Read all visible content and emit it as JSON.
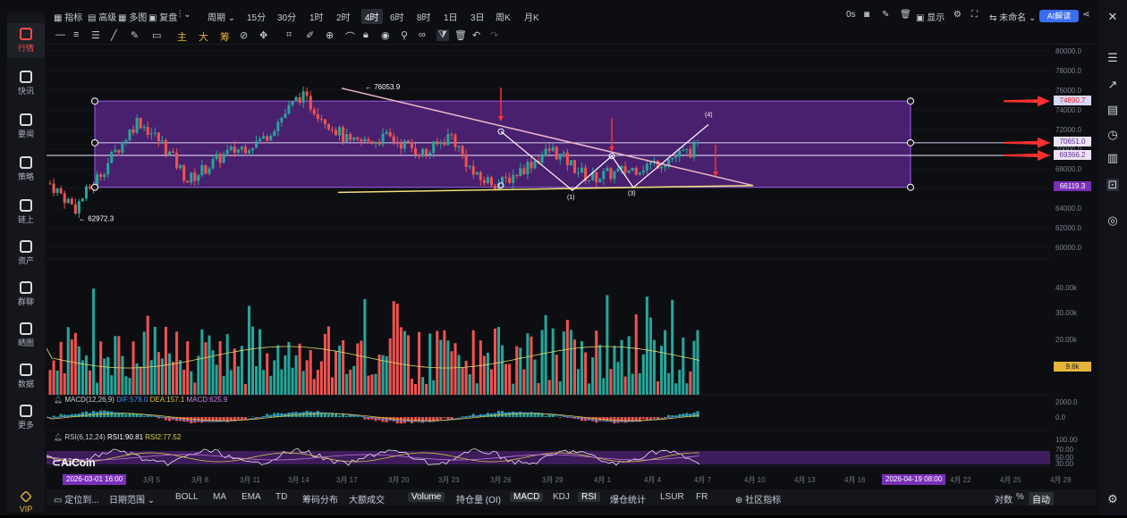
{
  "nav": [
    {
      "label": "行情",
      "icon": "bar-chart-icon",
      "active": true
    },
    {
      "label": "快讯",
      "icon": "news-icon"
    },
    {
      "label": "要闻",
      "icon": "document-icon"
    },
    {
      "label": "策略",
      "icon": "robot-icon"
    },
    {
      "label": "链上",
      "icon": "chain-icon"
    },
    {
      "label": "资产",
      "icon": "wallet-icon"
    },
    {
      "label": "群聊",
      "icon": "chat-icon"
    },
    {
      "label": "晒图",
      "icon": "image-icon"
    },
    {
      "label": "数据",
      "icon": "monitor-icon"
    },
    {
      "label": "更多",
      "icon": "grid-icon"
    },
    {
      "label": "VIP",
      "icon": "diamond-icon"
    }
  ],
  "topbar": {
    "indicators": "指标",
    "advanced": "高级",
    "multi": "多图",
    "restore": "复盘",
    "period": "周期",
    "timeframes": [
      "15分",
      "30分",
      "1时",
      "2时",
      "4时",
      "6时",
      "8时",
      "1日",
      "3日",
      "周K",
      "月K"
    ],
    "active_tf": "4时",
    "zero_s": "0s",
    "show": "显示",
    "unnamed": "未命名",
    "ai": "AI解读"
  },
  "drawbar": {
    "main": "主",
    "big": "大",
    "chip": "筹"
  },
  "price_axis": [
    "80000.0",
    "78000.0",
    "76000.0",
    "74000.0",
    "72000.0",
    "70000.0",
    "68000.0",
    "66000.0",
    "64000.0",
    "62000.0",
    "60000.0"
  ],
  "price_tags": [
    {
      "value": "74890.7",
      "bg": "#d6d9f7",
      "color": "#e02020"
    },
    {
      "value": "70651.0",
      "bg": "#ede3f7",
      "color": "#5b2e8a"
    },
    {
      "value": "69366.2",
      "bg": "#ede3f7",
      "color": "#5b2e8a"
    },
    {
      "value": "66119.3",
      "bg": "#7a2fb8",
      "color": "#ffffff"
    }
  ],
  "annotations": {
    "high": "76053.9",
    "low": "62972.3",
    "wave_labels": [
      "(1)",
      "(3)",
      "(4)"
    ]
  },
  "volume_axis": [
    "40.00k",
    "30.00k",
    "20.00k"
  ],
  "volume_tag": "9.6k",
  "macd": {
    "name": "MACD(12,26,9)",
    "dif": "DIF:578.0",
    "dea": "DEA:157.1",
    "macd": "MACD:625.9",
    "axis": [
      "2000.0",
      "0.0"
    ]
  },
  "rsi": {
    "name": "RSI(6,12,24)",
    "rsi1": "RSI1:90.81",
    "rsi2": "RSI2:77.52",
    "axis": [
      "100.00",
      "70.00",
      "50.00",
      "30.00"
    ]
  },
  "logo": "AiCoin",
  "time_axis": [
    "3月 5",
    "3月 8",
    "3月 11",
    "3月 14",
    "3月 17",
    "3月 20",
    "3月 23",
    "3月 26",
    "3月 29",
    "4月 1",
    "4月 4",
    "4月 7",
    "4月 10",
    "4月 13",
    "4月 16",
    "4月 22",
    "4月 25",
    "4月 28"
  ],
  "time_tags": [
    "2026-03-01 16:00",
    "2026-04-19 08:00"
  ],
  "bottombar": {
    "locate": "定位到...",
    "range": "日期范围",
    "indicators": [
      "BOLL",
      "MA",
      "EMA",
      "TD",
      "筹码分布",
      "大额成交",
      "Volume",
      "持仓量 (OI)",
      "MACD",
      "KDJ",
      "RSI",
      "爆仓统计",
      "LSUR",
      "FR",
      "社区指标"
    ],
    "active": [
      "Volume",
      "MACD",
      "RSI"
    ],
    "right": [
      "对数",
      "%",
      "自动"
    ]
  },
  "colors": {
    "up": "#26a69a",
    "down": "#ef5350",
    "band": "#7a2fb8",
    "trend": "#f0b8c8",
    "support": "#f2e07a"
  }
}
